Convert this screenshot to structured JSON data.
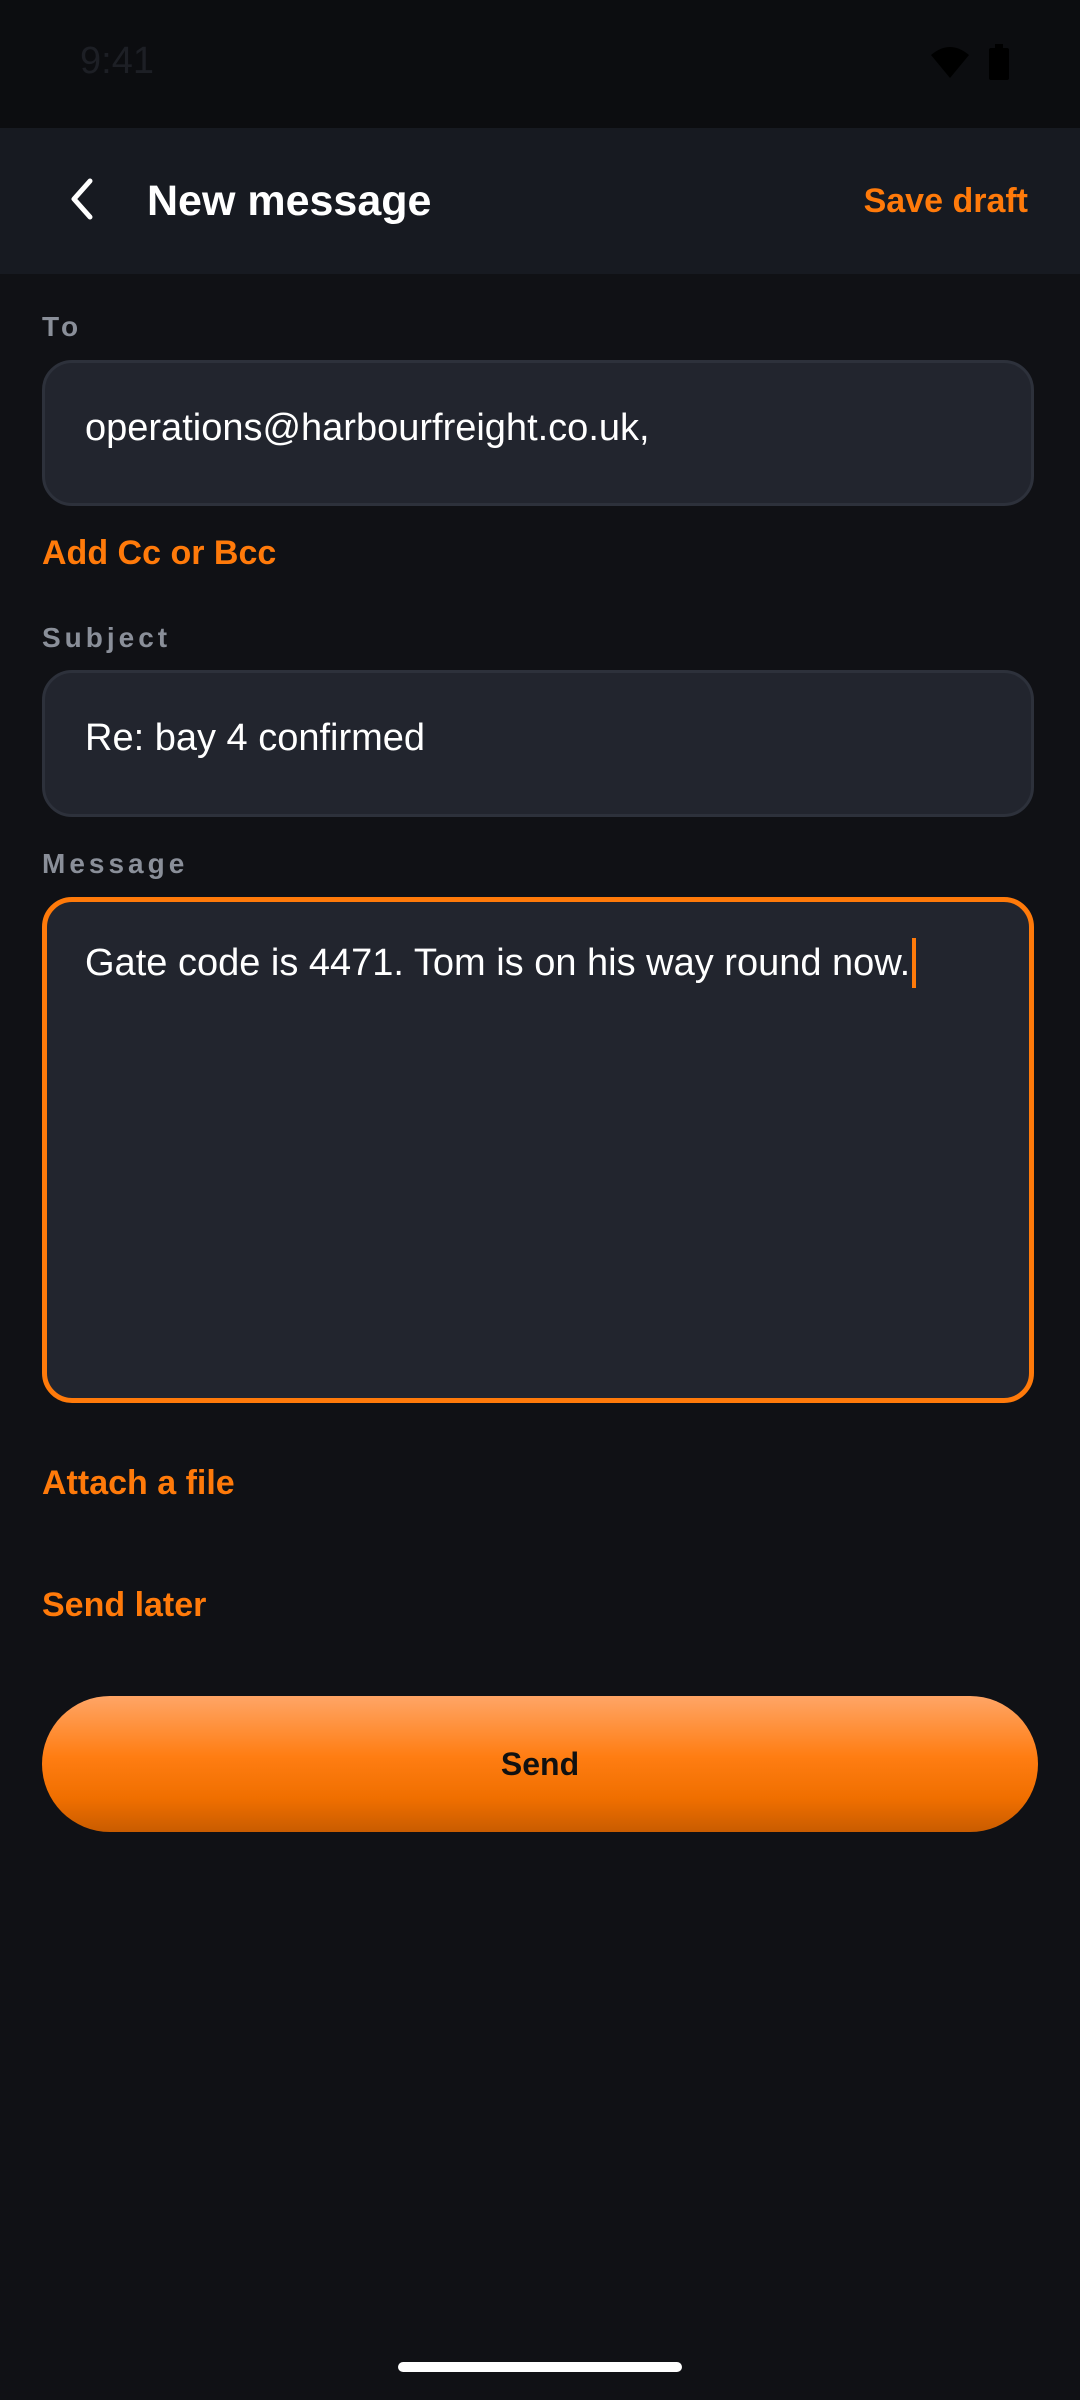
{
  "status_bar": {
    "time": "9:41",
    "icons": [
      "wifi-icon",
      "battery-icon"
    ]
  },
  "app_bar": {
    "back_icon": "chevron-left-icon",
    "title": "New message",
    "save_draft_label": "Save draft"
  },
  "form": {
    "to": {
      "label": "To",
      "value": "operations@harbourfreight.co.uk,"
    },
    "add_cc_bcc_label": "Add Cc or Bcc",
    "subject": {
      "label": "Subject",
      "value": "Re: bay 4 confirmed"
    },
    "message": {
      "label": "Message",
      "value": "Gate code is 4471. Tom is on his way round now."
    }
  },
  "actions": {
    "attach_label": "Attach a file",
    "send_later_label": "Send later",
    "send_label": "Send"
  },
  "colors": {
    "accent": "#ff7a0a",
    "background": "#101115",
    "app_bar": "#171a21",
    "field": "#22252e"
  }
}
